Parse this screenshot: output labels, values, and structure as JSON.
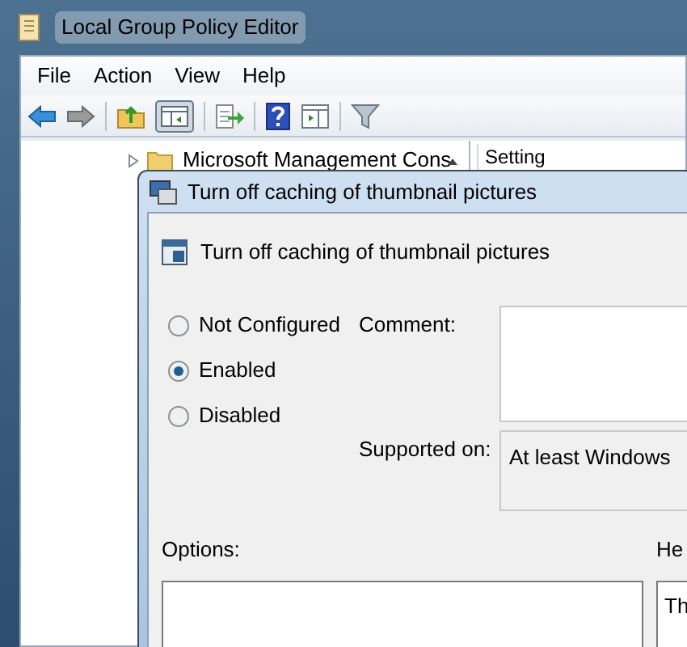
{
  "window": {
    "title": "Local Group Policy Editor"
  },
  "menu": [
    "File",
    "Action",
    "View",
    "Help"
  ],
  "tree": {
    "items": [
      {
        "label": "Microsoft Management Cons",
        "expanded": false
      }
    ]
  },
  "list": {
    "columns": [
      "Setting"
    ]
  },
  "dialog": {
    "title": "Turn off caching of thumbnail pictures",
    "heading": "Turn off caching of thumbnail pictures",
    "states": [
      {
        "label": "Not Configured",
        "selected": false
      },
      {
        "label": "Enabled",
        "selected": true
      },
      {
        "label": "Disabled",
        "selected": false
      }
    ],
    "comment_label": "Comment:",
    "supported_label": "Supported on:",
    "supported_value": "At least Windows",
    "options_label": "Options:",
    "help_label": "He",
    "help_text": "Th"
  }
}
